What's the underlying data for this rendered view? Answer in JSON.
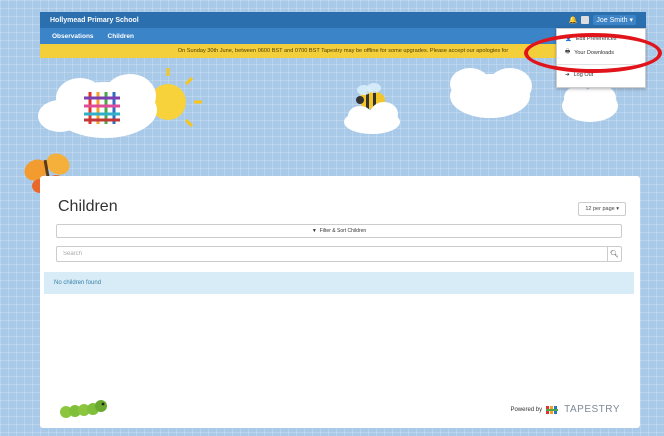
{
  "header": {
    "school_name": "Hollymead Primary School",
    "user_name": "Joe Smith",
    "bell_icon": "bell-icon",
    "caret": "▾"
  },
  "nav": {
    "items": [
      {
        "label": "Observations"
      },
      {
        "label": "Children"
      }
    ]
  },
  "banner": {
    "text": "On Sunday 30th June, between 0600 BST and 0700 BST Tapestry may be offline for some upgrades. Please accept our apologies for"
  },
  "user_menu": {
    "items": [
      {
        "label": "Edit Preferences",
        "icon": "user-icon"
      },
      {
        "label": "Your Downloads",
        "icon": "download-icon"
      },
      {
        "label": "Log Out",
        "icon": "logout-icon"
      }
    ]
  },
  "main": {
    "title": "Children",
    "per_page": "12 per page ▾",
    "filter_label": "Filter & Sort Children",
    "search_placeholder": "Search",
    "empty_message": "No children found"
  },
  "footer": {
    "powered_by": "Powered by",
    "brand": "TAPESTRY"
  },
  "colors": {
    "topbar": "#2b6fae",
    "navbar": "#3b84c8",
    "banner": "#f4cf3c",
    "highlight": "#e0141a",
    "info": "#d7ecf6"
  }
}
